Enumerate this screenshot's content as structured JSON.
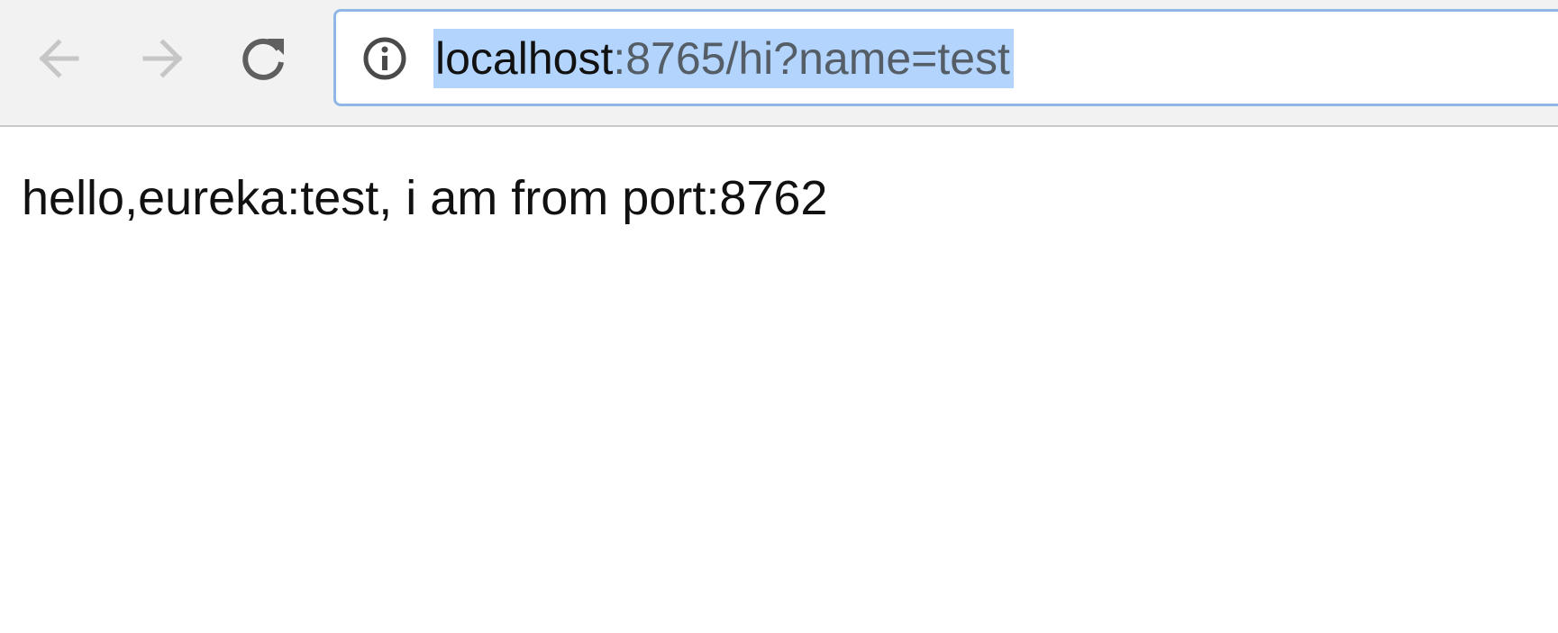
{
  "toolbar": {
    "back_icon": "back-arrow-icon",
    "forward_icon": "forward-arrow-icon",
    "reload_icon": "reload-icon",
    "info_icon": "info-icon"
  },
  "address_bar": {
    "host": "localhost",
    "path": ":8765/hi?name=test",
    "selected": true
  },
  "page": {
    "body_text": "hello,eureka:test, i am from port:8762"
  },
  "colors": {
    "selection_highlight": "#b3d4fc",
    "omnibox_focus_border": "#8fb6e4",
    "toolbar_bg": "#f2f2f2"
  }
}
